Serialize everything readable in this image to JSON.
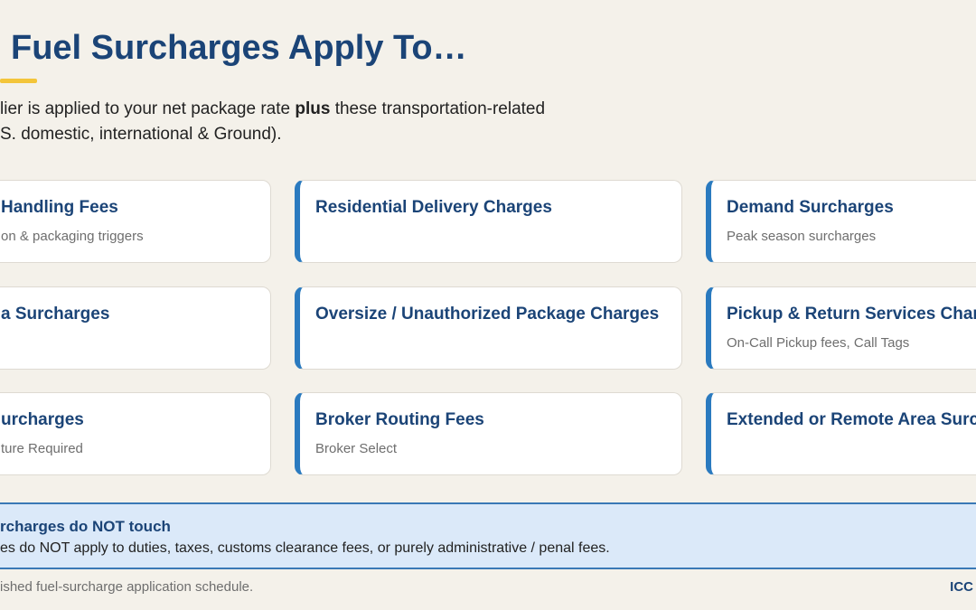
{
  "header": {
    "title": "Fuel Surcharges Apply To…"
  },
  "intro": {
    "line1_prefix": "lier is applied to your net package rate ",
    "line1_bold": "plus",
    "line1_suffix": " these transportation-related",
    "line2": "S. domestic, international & Ground)."
  },
  "cards": [
    {
      "title": "Handling Fees",
      "subtitle": "on & packaging triggers"
    },
    {
      "title": "Residential Delivery Charges",
      "subtitle": ""
    },
    {
      "title": "Demand Surcharges",
      "subtitle": "Peak season surcharges"
    },
    {
      "title": "a Surcharges",
      "subtitle": ""
    },
    {
      "title": "Oversize / Unauthorized Package Charges",
      "subtitle": ""
    },
    {
      "title": "Pickup & Return Services Charg",
      "subtitle": "On-Call Pickup fees, Call Tags"
    },
    {
      "title": "urcharges",
      "subtitle": "ture Required"
    },
    {
      "title": "Broker Routing Fees",
      "subtitle": "Broker Select"
    },
    {
      "title": "Extended or Remote Area Surch",
      "subtitle": ""
    }
  ],
  "callout": {
    "title": "rcharges do NOT touch",
    "body": "es do NOT apply to duties, taxes, customs clearance fees, or purely administrative / penal fees."
  },
  "footer": {
    "note": "ished fuel-surcharge application schedule.",
    "brand": "ICC"
  },
  "colors": {
    "background": "#f4f1ea",
    "heading": "#1b4477",
    "accent_bar": "#2a7abf",
    "underline": "#f3c53a",
    "callout_bg": "#dbe9f9"
  }
}
